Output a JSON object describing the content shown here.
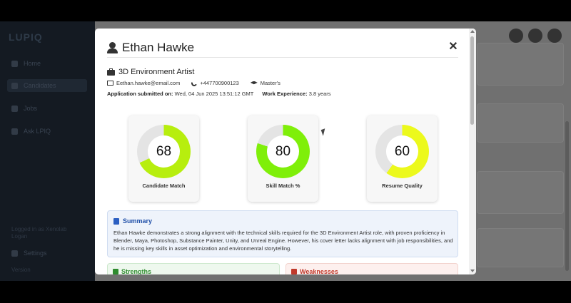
{
  "sidebar": {
    "logo": "LUPIQ",
    "items": [
      {
        "label": "Home"
      },
      {
        "label": "Candidates"
      },
      {
        "label": "Jobs"
      },
      {
        "label": "Ask LPIQ"
      }
    ],
    "footer_login": "Logged in as Xenolab Logan",
    "settings": "Settings",
    "version": "Version"
  },
  "modal": {
    "candidate_name": "Ethan Hawke",
    "job_title": "3D Environment Artist",
    "email": "Eethan.hawke@email.com",
    "phone": "+447700900123",
    "degree": "Master's",
    "submitted_label": "Application submitted on:",
    "submitted_value": "Wed, 04 Jun 2025 13:51:12 GMT",
    "experience_label": "Work Experience:",
    "experience_value": "3.8 years",
    "close_symbol": "✕",
    "scores": [
      {
        "label": "Candidate Match",
        "value": "68",
        "percent": 68,
        "color": "#b7ee0e"
      },
      {
        "label": "Skill Match %",
        "value": "80",
        "percent": 80,
        "color": "#7fef09"
      },
      {
        "label": "Resume Quality",
        "value": "60",
        "percent": 60,
        "color": "#ecf91c"
      }
    ],
    "summary_title": "Summary",
    "summary_text": "Ethan Hawke demonstrates a strong alignment with the technical skills required for the 3D Environment Artist role, with proven proficiency in Blender, Maya, Photoshop, Substance Painter, Unity, and Unreal Engine. However, his cover letter lacks alignment with job responsibilities, and he is missing key skills in asset optimization and environmental storytelling.",
    "strengths_title": "Strengths",
    "weaknesses_title": "Weaknesses"
  },
  "colors": {
    "summary_accent": "#1f4fa8",
    "strength_accent": "#2e8b2e",
    "weakness_accent": "#c0392b",
    "ring_track": "#e4e4e4"
  }
}
